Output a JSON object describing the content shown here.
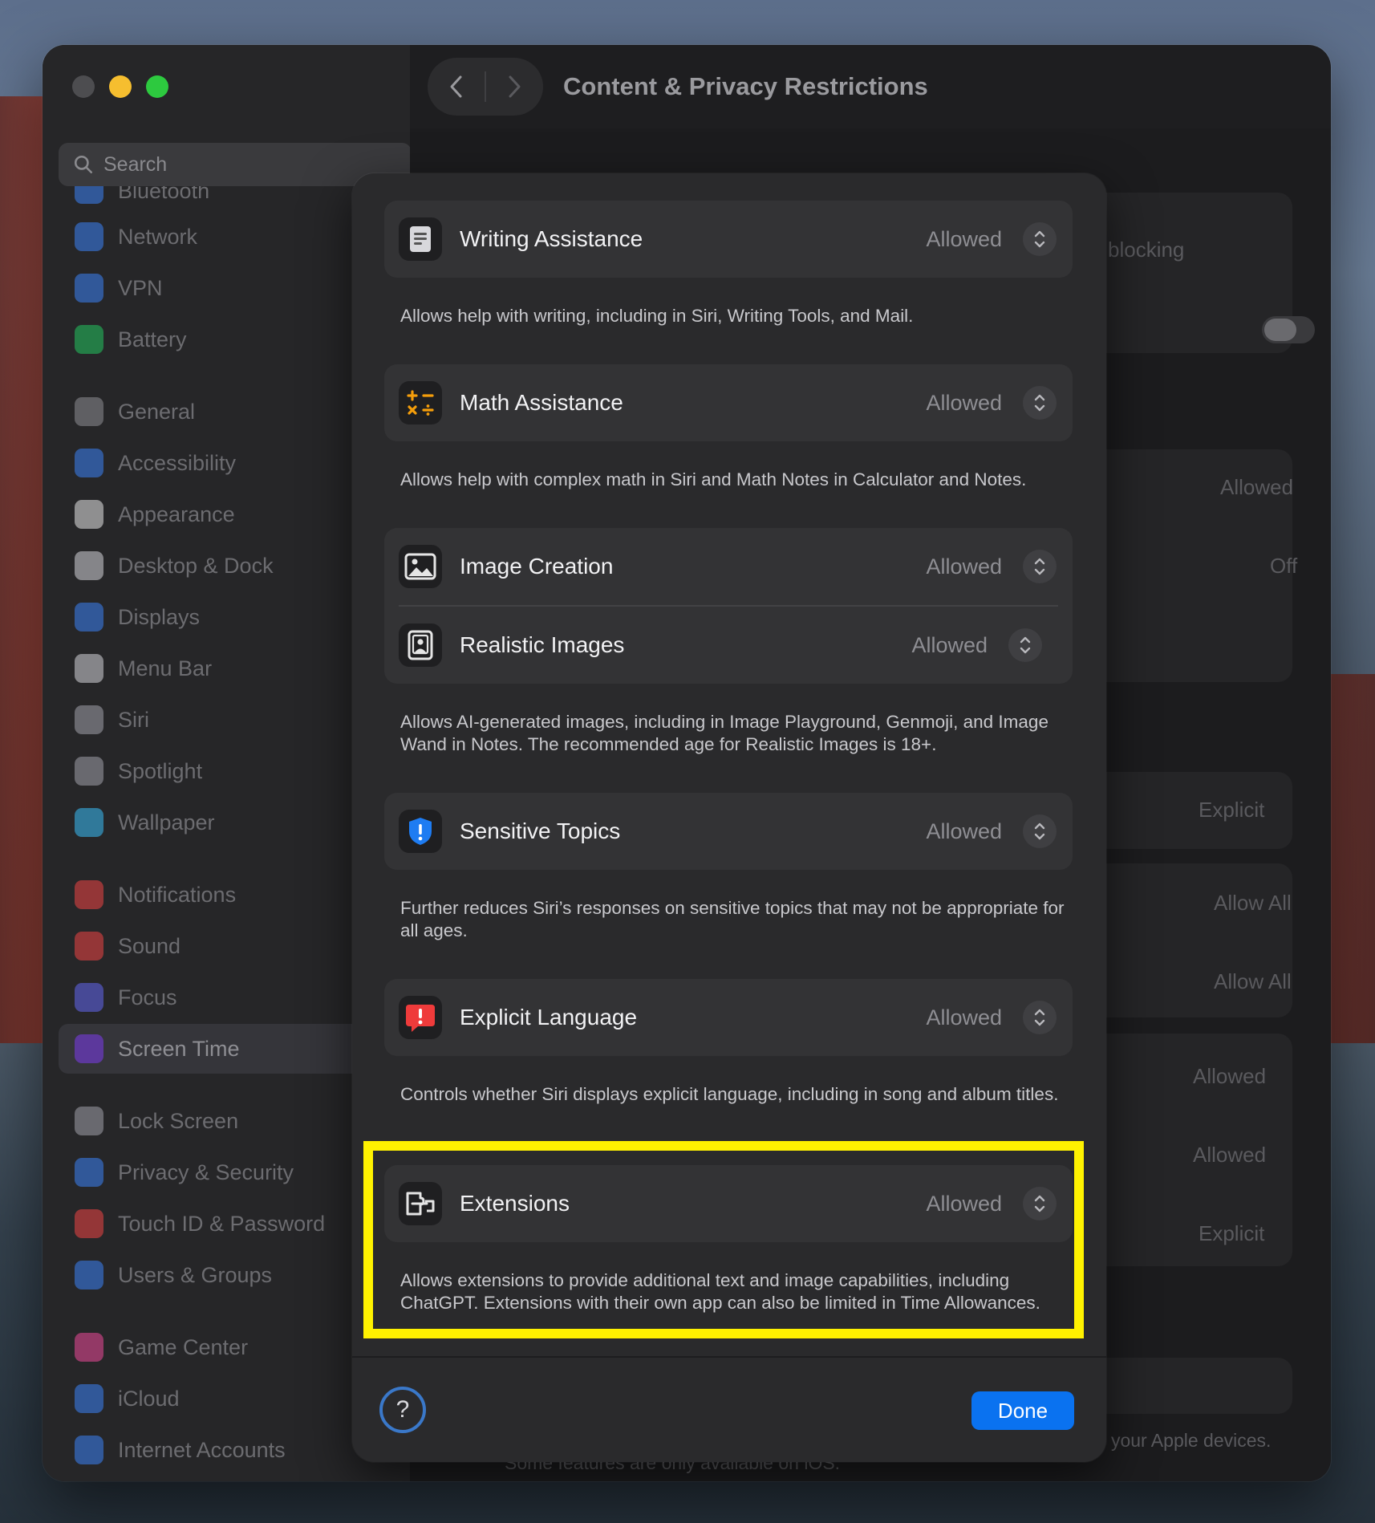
{
  "window": {
    "title": "Content & Privacy Restrictions"
  },
  "search": {
    "placeholder": "Search"
  },
  "sidebar": {
    "items": [
      {
        "label": "Network",
        "icon": "globe-icon",
        "color": "#3b82f6"
      },
      {
        "label": "VPN",
        "icon": "vpn-icon",
        "color": "#3b82f6"
      },
      {
        "label": "Battery",
        "icon": "battery-icon",
        "color": "#22c55e"
      },
      {
        "label": "General",
        "icon": "gear-icon",
        "color": "#8e8e93"
      },
      {
        "label": "Accessibility",
        "icon": "accessibility-icon",
        "color": "#3b82f6"
      },
      {
        "label": "Appearance",
        "icon": "appearance-icon",
        "color": "#e5e5e5"
      },
      {
        "label": "Desktop & Dock",
        "icon": "dock-icon",
        "color": "#d4d4d8"
      },
      {
        "label": "Displays",
        "icon": "sun-icon",
        "color": "#3b82f6"
      },
      {
        "label": "Menu Bar",
        "icon": "menubar-icon",
        "color": "#d4d4d8"
      },
      {
        "label": "Siri",
        "icon": "siri-icon",
        "color": "#a1a1aa"
      },
      {
        "label": "Spotlight",
        "icon": "spotlight-icon",
        "color": "#a1a1aa"
      },
      {
        "label": "Wallpaper",
        "icon": "wallpaper-icon",
        "color": "#38bdf8"
      },
      {
        "label": "Notifications",
        "icon": "bell-icon",
        "color": "#ef4444"
      },
      {
        "label": "Sound",
        "icon": "speaker-icon",
        "color": "#ef4444"
      },
      {
        "label": "Focus",
        "icon": "moon-icon",
        "color": "#6366f1"
      },
      {
        "label": "Screen Time",
        "icon": "hourglass-icon",
        "color": "#7c3aed"
      },
      {
        "label": "Lock Screen",
        "icon": "lock-icon",
        "color": "#a1a1aa"
      },
      {
        "label": "Privacy & Security",
        "icon": "hand-icon",
        "color": "#3b82f6"
      },
      {
        "label": "Touch ID & Password",
        "icon": "fingerprint-icon",
        "color": "#ef4444"
      },
      {
        "label": "Users & Groups",
        "icon": "users-icon",
        "color": "#3b82f6"
      },
      {
        "label": "Game Center",
        "icon": "game-center-icon",
        "color": "#ec4899"
      },
      {
        "label": "iCloud",
        "icon": "cloud-icon",
        "color": "#3b82f6"
      },
      {
        "label": "Internet Accounts",
        "icon": "at-icon",
        "color": "#3b82f6"
      }
    ],
    "partial_top": "Bluetooth"
  },
  "background": {
    "blocking": "blocking",
    "values": [
      "Allowed",
      "Off",
      "Explicit",
      "Allow All",
      "Allow All",
      "Allowed",
      "Allowed",
      "Explicit"
    ],
    "apple_devices": "ed on your Apple devices.",
    "ios_note": "Some features are only available on iOS."
  },
  "sheet": {
    "sections": [
      {
        "rows": [
          {
            "label": "Writing Assistance",
            "value": "Allowed",
            "icon": "document-icon"
          }
        ],
        "description": "Allows help with writing, including in Siri, Writing Tools, and Mail."
      },
      {
        "rows": [
          {
            "label": "Math Assistance",
            "value": "Allowed",
            "icon": "math-icon"
          }
        ],
        "description": "Allows help with complex math in Siri and Math Notes in Calculator and Notes."
      },
      {
        "rows": [
          {
            "label": "Image Creation",
            "value": "Allowed",
            "icon": "photo-icon"
          },
          {
            "label": "Realistic Images",
            "value": "Allowed",
            "icon": "portrait-icon"
          }
        ],
        "description": "Allows AI-generated images, including in Image Playground, Genmoji, and Image Wand in Notes. The recommended age for Realistic Images is 18+."
      },
      {
        "rows": [
          {
            "label": "Sensitive Topics",
            "value": "Allowed",
            "icon": "shield-icon"
          }
        ],
        "description": "Further reduces Siri’s responses on sensitive topics that may not be appropriate for all ages."
      },
      {
        "rows": [
          {
            "label": "Explicit Language",
            "value": "Allowed",
            "icon": "explicit-icon"
          }
        ],
        "description": "Controls whether Siri displays explicit language, including in song and album titles."
      },
      {
        "rows": [
          {
            "label": "Extensions",
            "value": "Allowed",
            "icon": "extensions-icon"
          }
        ],
        "description": "Allows extensions to provide additional text and image capabilities, including ChatGPT. Extensions with their own app can also be limited in Time Allowances."
      }
    ],
    "help_label": "?",
    "done_label": "Done"
  },
  "colors": {
    "accent": "#0a72f0",
    "highlight": "#fff200"
  }
}
